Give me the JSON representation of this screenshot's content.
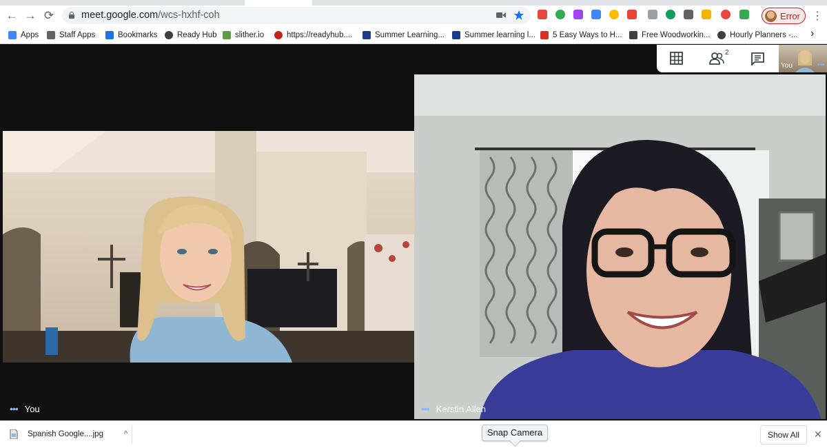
{
  "browser": {
    "url_host": "meet.google.com",
    "url_path": "/wcs-hxhf-coh",
    "profile_label": "Error",
    "nav": {
      "back": "←",
      "forward": "→",
      "reload": "⟳",
      "menu": "⋮"
    },
    "extension_colors": [
      "#e8453c",
      "#34a853",
      "#a142f4",
      "#4285f4",
      "#fbbc04",
      "#ea4335",
      "#9aa0a6",
      "#0f9d58",
      "#5f6368",
      "#f4b400"
    ],
    "bookmarks": [
      {
        "label": "Apps",
        "icon": "apps-grid-icon"
      },
      {
        "label": "Staff Apps",
        "icon": "folder-icon"
      },
      {
        "label": "Bookmarks",
        "icon": "star-icon"
      },
      {
        "label": "Ready Hub",
        "icon": "globe-icon"
      },
      {
        "label": "slither.io",
        "icon": "slither-icon"
      },
      {
        "label": "https://readyhub....",
        "icon": "link-icon"
      },
      {
        "label": "Summer Learning...",
        "icon": "checkbox-icon"
      },
      {
        "label": "Summer learning l...",
        "icon": "b-icon"
      },
      {
        "label": "5 Easy Ways to H...",
        "icon": "s-icon"
      },
      {
        "label": "Free Woodworkin...",
        "icon": "tool-icon"
      },
      {
        "label": "Hourly Planners -...",
        "icon": "globe-icon"
      }
    ],
    "bookmarks_more": "›"
  },
  "meet": {
    "participants": [
      {
        "name": "You",
        "menu": "•••"
      },
      {
        "name": "Kerstin Allen",
        "menu": "•••"
      }
    ],
    "participant_count": "2",
    "self_label": "You",
    "self_menu": "•••"
  },
  "downloads": {
    "file_name": "Spanish Google....jpg",
    "chevron": "^",
    "show_all": "Show All",
    "close": "✕"
  },
  "tooltip": "Snap Camera"
}
